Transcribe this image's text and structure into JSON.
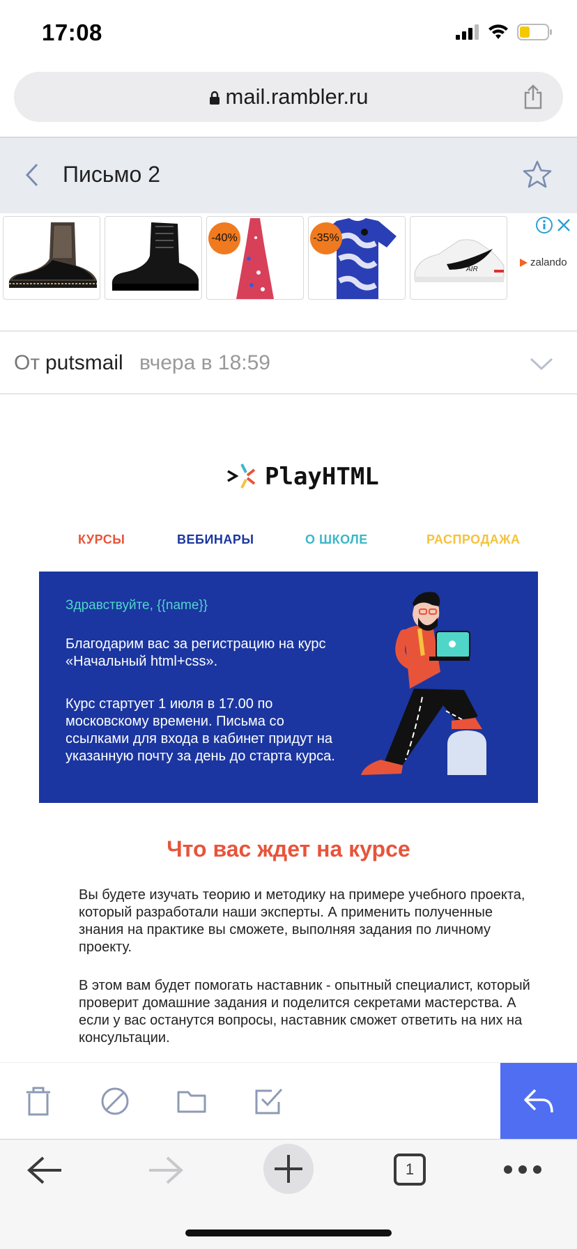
{
  "status": {
    "time": "17:08"
  },
  "browser": {
    "url": "mail.rambler.ru",
    "tab_count": "1"
  },
  "mail": {
    "header_title": "Письмо 2",
    "from_label": "От",
    "from_name": "putsmail",
    "date": "вчера в 18:59"
  },
  "ads": {
    "badges": [
      "-40%",
      "-35%"
    ],
    "brand": "zalando",
    "shoe_brand": "AIR"
  },
  "email": {
    "logo": "PlayHTML",
    "logo_mark": ">",
    "nav": [
      "КУРСЫ",
      "ВЕБИНАРЫ",
      "О ШКОЛЕ",
      "РАСПРОДАЖА"
    ],
    "nav_colors": [
      "#e8543a",
      "#1b36a0",
      "#3ab7c8",
      "#f5c23d"
    ],
    "greeting": "Здравствуйте, {{name}}",
    "banner_p1": "Благодарим вас за регистрацию на курс «Начальный html+css».",
    "banner_p2": "Курс стартует 1 июля в 17.00 по московскому времени. Письма со ссылками для входа в кабинет придут на указанную почту за день до старта курса.",
    "section_title": "Что вас ждет на курсе",
    "section_p1": "Вы будете изучать теорию и методику на примере учебного проекта, который разработали наши эксперты. А применить полученные знания на практике вы сможете, выполняя задания по личному проекту.",
    "section_p2": "В этом вам будет помогать наставник - опытный специалист, который проверит домашние задания и поделится секретами мастерства. А если у вас останутся вопросы, наставник сможет ответить на них на консультации."
  },
  "colors": {
    "accent_blue": "#4f6ef2",
    "banner_blue": "#1b36a0",
    "title_red": "#e8543a"
  },
  "icons": [
    "signal-icon",
    "wifi-icon",
    "battery-icon",
    "lock-icon",
    "share-icon",
    "back-chevron-icon",
    "star-icon",
    "info-icon",
    "close-icon",
    "chevron-down-icon",
    "trash-icon",
    "block-icon",
    "folder-icon",
    "checkbox-icon",
    "reply-icon",
    "back-arrow-icon",
    "forward-arrow-icon",
    "plus-icon",
    "tabs-icon",
    "more-icon"
  ]
}
